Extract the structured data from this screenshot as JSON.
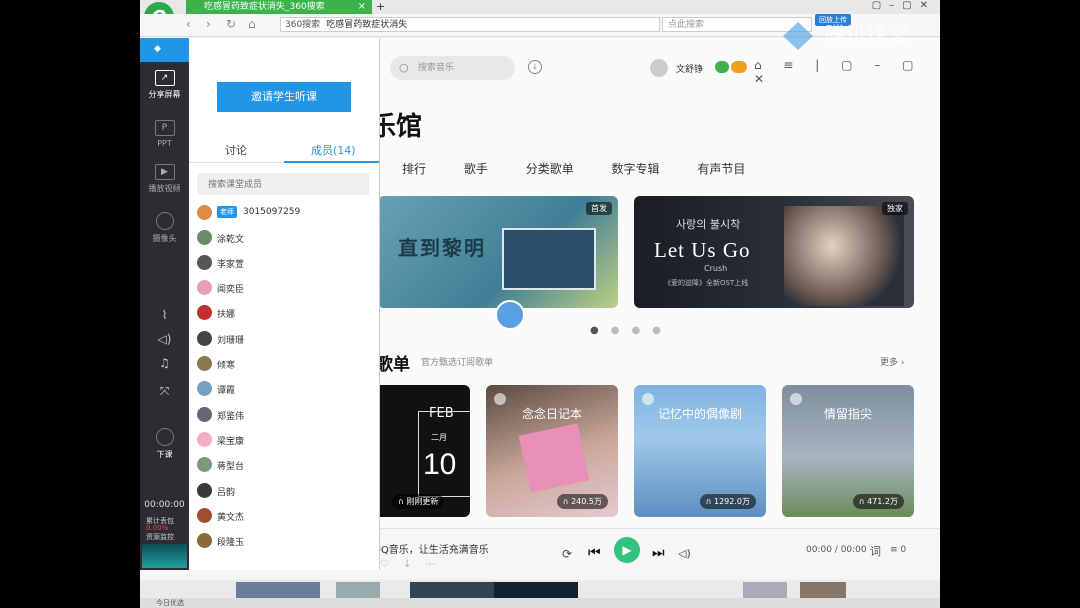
{
  "browser": {
    "tab_title": "吃感冒药致症状消失_360搜索",
    "logo": "e",
    "address_prefix": "360搜索",
    "address_text": "吃感冒药致症状消失",
    "search_placeholder": "点此搜索"
  },
  "watermark": {
    "text": "腾讯课堂",
    "badge": "回放上传"
  },
  "classroom": {
    "sidebar": {
      "items": [
        {
          "label": "分享屏幕"
        },
        {
          "label": "PPT"
        },
        {
          "label": "播放视频"
        },
        {
          "label": "摄像头"
        }
      ],
      "end_label": "下课",
      "timer": "00:00:00",
      "stat1": "累计丢包",
      "stat2": "0.00%",
      "stat3": "资源监控"
    },
    "panel": {
      "invite_button": "邀请学生听课",
      "tab_discussion": "讨论",
      "tab_members": "成员(14)",
      "search_placeholder": "搜索课堂成员",
      "teacher_badge": "老师",
      "members": [
        "3015097259",
        "涂乾文",
        "李家萱",
        "闻奕臣",
        "扶娜",
        "刘珊珊",
        "倾寒",
        "谭霞",
        "郑鉴伟",
        "梁宝康",
        "蒋型台",
        "吕韵",
        "黄文杰",
        "段隆玉"
      ]
    }
  },
  "music": {
    "search_placeholder": "搜索音乐",
    "user_name": "文舒铮",
    "page_title": "乐馆",
    "tabs": [
      "排行",
      "歌手",
      "分类歌单",
      "数字专辑",
      "有声节目"
    ],
    "banner1": {
      "tag": "首发",
      "text": "直到黎明"
    },
    "banner2": {
      "tag": "独家",
      "title": "Let Us Go",
      "korean": "사랑의 불시착",
      "sub": "Crush",
      "caption": "《爱的迫降》全新OST上线"
    },
    "section": {
      "title": "歌单",
      "subtitle": "官方甄选订阅歌单",
      "more": "更多"
    },
    "cards": [
      {
        "title": "",
        "month": "FEB",
        "sub": "二月",
        "day": "10",
        "plays": "刚刚更新"
      },
      {
        "title": "念念日记本",
        "plays": "240.5万"
      },
      {
        "title": "记忆中的偶像剧",
        "plays": "1292.0万"
      },
      {
        "title": "情留指尖",
        "plays": "471.2万"
      }
    ],
    "player": {
      "message": "QQ音乐，让生活充满音乐",
      "time": "00:00 / 00:00",
      "lyric": "词",
      "playlist_count": "0"
    }
  },
  "statusbar": "今日优选"
}
